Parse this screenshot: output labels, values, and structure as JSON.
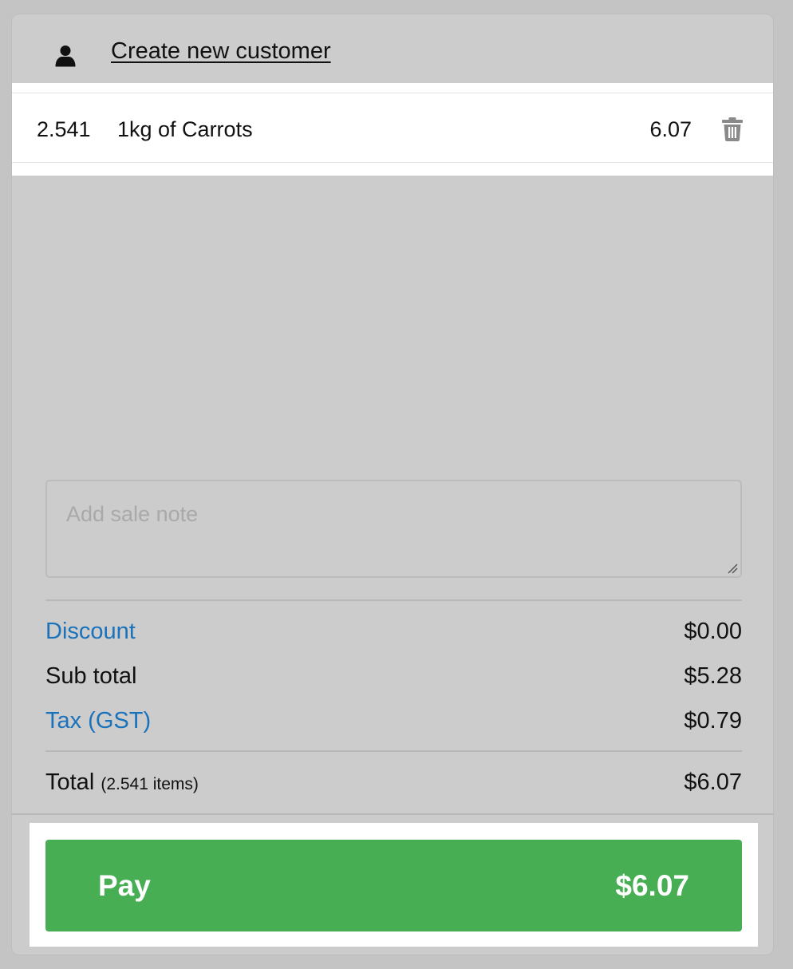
{
  "customer": {
    "create_label": "Create new customer",
    "icon": "user-icon"
  },
  "line_items": [
    {
      "quantity": "2.541",
      "name": "1kg of Carrots",
      "price": "6.07",
      "delete_icon": "trash-icon"
    }
  ],
  "sale_note": {
    "placeholder": "Add sale note",
    "value": ""
  },
  "totals": {
    "discount_label": "Discount",
    "discount_value": "$0.00",
    "subtotal_label": "Sub total",
    "subtotal_value": "$5.28",
    "tax_label": "Tax (GST)",
    "tax_value": "$0.79",
    "total_label": "Total",
    "total_items": "(2.541 items)",
    "total_value": "$6.07"
  },
  "pay": {
    "label": "Pay",
    "amount": "$6.07"
  },
  "colors": {
    "pay_button": "#47ae53",
    "link": "#1a72bb",
    "panel_background": "#cccccc"
  }
}
